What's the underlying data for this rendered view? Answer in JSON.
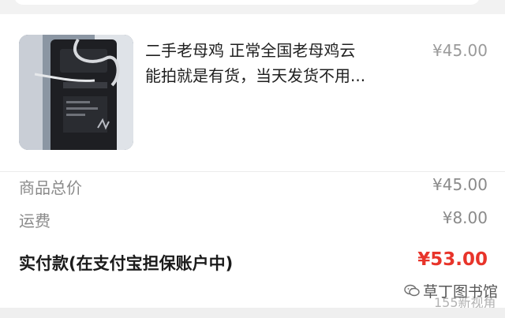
{
  "product": {
    "title_line1": "二手老母鸡 正常全国老母鸡云",
    "title_line2": "能拍就是有货，当天发货不用...",
    "price": "¥45.00",
    "image_icon": "product-photo-charger"
  },
  "summary": {
    "goods_total_label": "商品总价",
    "goods_total_value": "¥45.00",
    "shipping_label": "运费",
    "shipping_value": "¥8.00",
    "paid_label": "实付款(在支付宝担保账户中)",
    "paid_value": "¥53.00"
  },
  "watermark": {
    "brand": "草丁图书馆",
    "sub": "155新视角",
    "icon": "wechat-icon"
  },
  "colors": {
    "accent_red": "#e8342a",
    "muted_text": "#8a8a8a",
    "page_bg": "#f2f2f2"
  }
}
